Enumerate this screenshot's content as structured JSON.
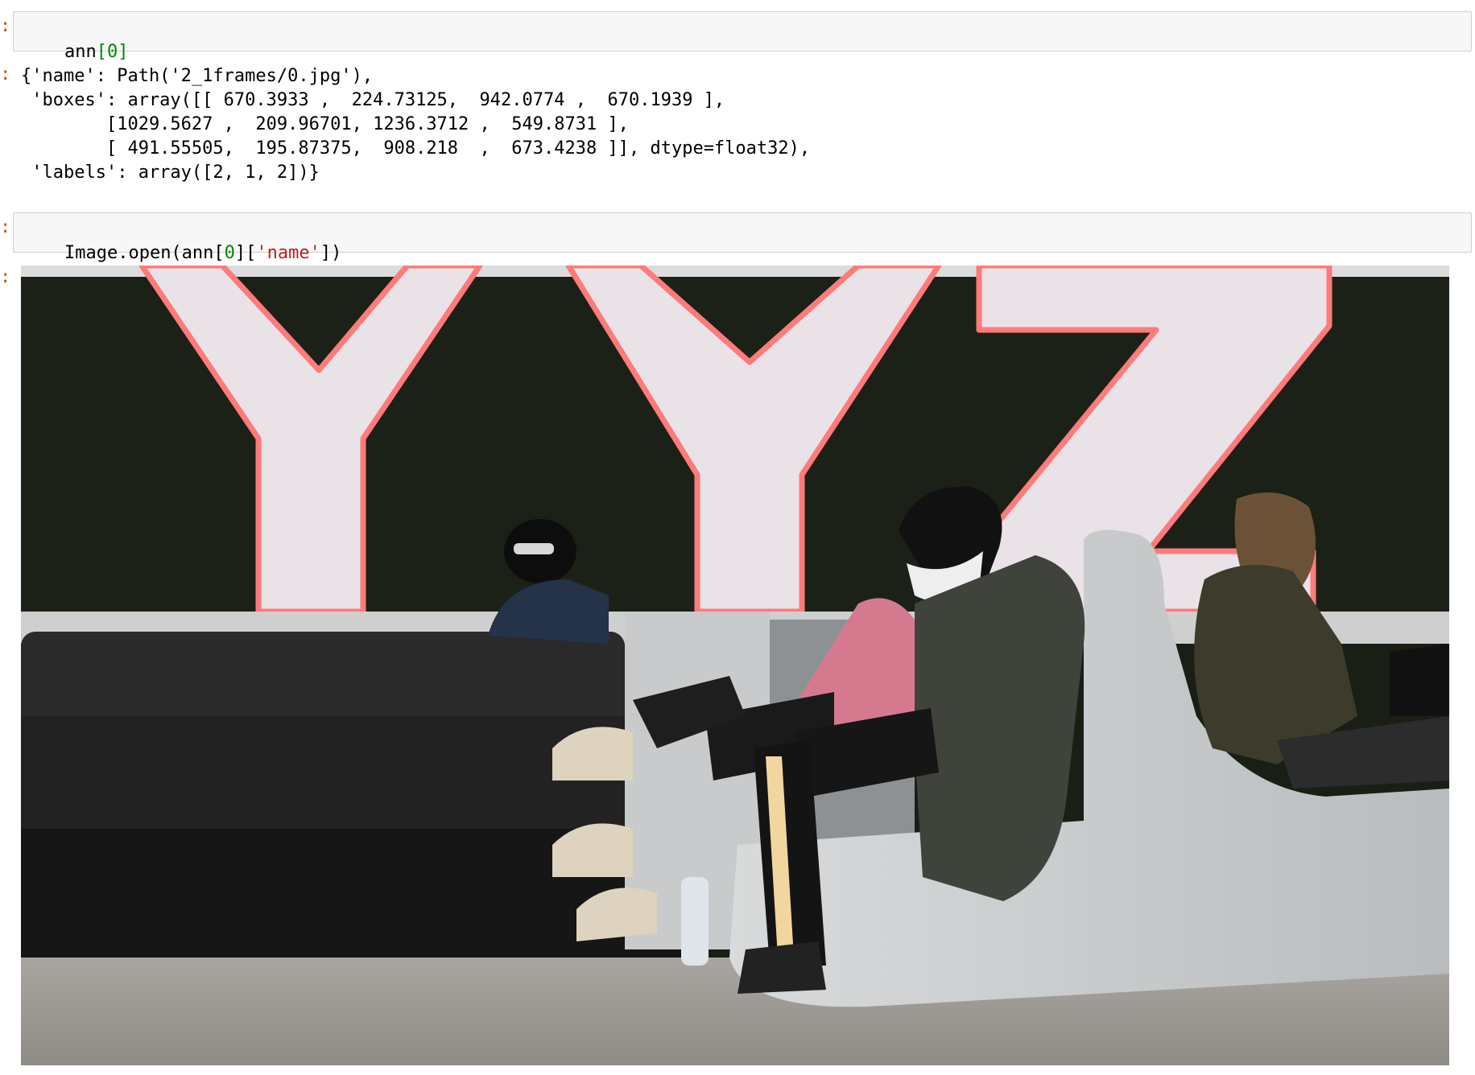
{
  "cells": [
    {
      "input_tokens": [
        {
          "text": "ann",
          "kind": "plain"
        },
        {
          "text": "[",
          "kind": "num"
        },
        {
          "text": "0",
          "kind": "num"
        },
        {
          "text": "]",
          "kind": "num"
        }
      ],
      "output_lines": [
        "{'name': Path('2_1frames/0.jpg'),",
        " 'boxes': array([[ 670.3933 ,  224.73125,  942.0774 ,  670.1939 ],",
        "        [1029.5627 ,  209.96701, 1236.3712 ,  549.8731 ],",
        "        [ 491.55505,  195.87375,  908.218  ,  673.4238 ]], dtype=float32),",
        " 'labels': array([2, 1, 2])}"
      ]
    },
    {
      "input_tokens": [
        {
          "text": "Image.open(ann[",
          "kind": "plain"
        },
        {
          "text": "0",
          "kind": "num"
        },
        {
          "text": "][",
          "kind": "plain"
        },
        {
          "text": "'name'",
          "kind": "str"
        },
        {
          "text": "])",
          "kind": "plain"
        }
      ],
      "output_image": {
        "description_icon": "photo-airport-lounge",
        "sign_letters": [
          "Y",
          "Y",
          "Z"
        ]
      }
    }
  ],
  "colors": {
    "prompt": "#d84315",
    "number": "#008800",
    "string": "#ba2121",
    "neon": "#ff7a7a"
  }
}
